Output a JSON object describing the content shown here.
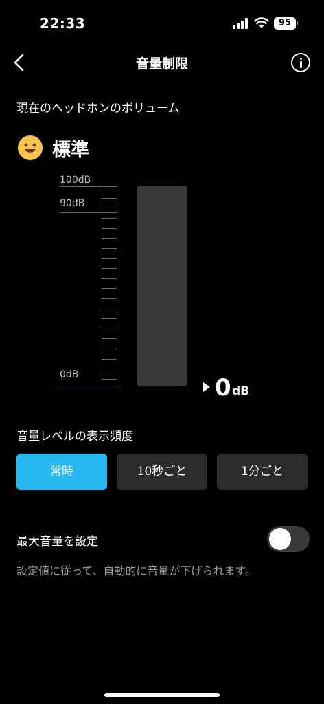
{
  "status_bar": {
    "time": "22:33",
    "battery": "95"
  },
  "header": {
    "title": "音量制限",
    "back_icon": "chevron-left-icon",
    "info_icon": "info-icon"
  },
  "current_volume": {
    "label": "現在のヘッドホンのボリューム",
    "status": "標準",
    "status_icon": "smiling-face-icon",
    "scale_labels": [
      "100dB",
      "90dB",
      "0dB"
    ],
    "value": "0",
    "unit": "dB",
    "level_fraction": 0
  },
  "display_frequency": {
    "label": "音量レベルの表示頻度",
    "options": [
      "常時",
      "10秒ごと",
      "1分ごと"
    ],
    "selected": "常時"
  },
  "max_volume": {
    "label": "最大音量を設定",
    "enabled": false,
    "description": "設定値に従って、自動的に音量が下げられます。"
  },
  "colors": {
    "accent": "#28b8f0",
    "background": "#000000",
    "segment": "#2c2c2e",
    "emoji": "#f6c451"
  }
}
